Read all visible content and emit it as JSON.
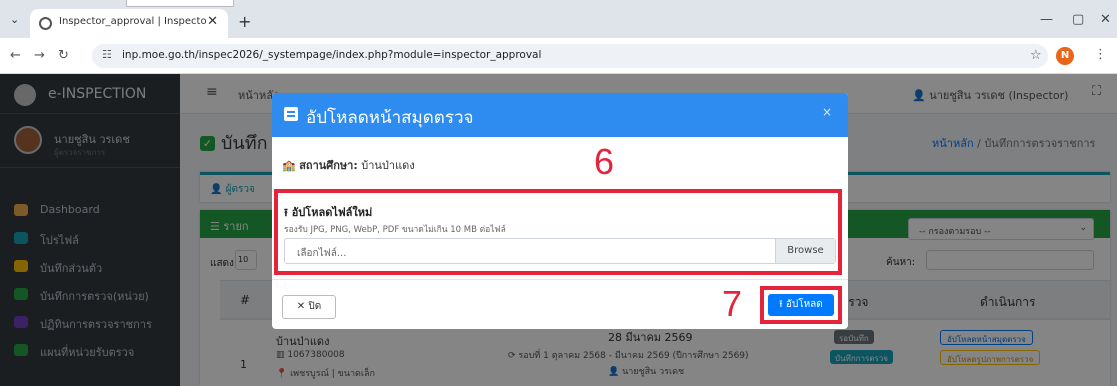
{
  "browser": {
    "tab_title": "Inspector_approval | Inspector",
    "tab_close": "✕",
    "new_tab": "+",
    "url": "inp.moe.go.th/inspec2026/_systempage/index.php?module=inspector_approval",
    "profile_initial": "N",
    "tab_list": "⌄",
    "minimize": "—",
    "maximize": "▢",
    "close": "✕"
  },
  "sidebar": {
    "brand": "e-INSPECTION",
    "user_name": "นายชูสิน วรเดช",
    "user_role": "ผู้ตรวจราชการ",
    "items": [
      {
        "label": "Dashboard",
        "color": "#f0ad4e"
      },
      {
        "label": "โปรไฟล์",
        "color": "#17a2b8"
      },
      {
        "label": "บันทึกส่วนตัว",
        "color": "#ffc107"
      },
      {
        "label": "บันทึกการตรวจ(หน่วย)",
        "color": "#28a745"
      },
      {
        "label": "ปฏิทินการตรวจราชการ",
        "color": "#6f42c1"
      },
      {
        "label": "แผนที่หน่วยรับตรวจ",
        "color": "#28a745"
      }
    ]
  },
  "topnav": {
    "home": "หน้าหลัก",
    "user": "นายชูสิน วรเดช (Inspector)"
  },
  "content": {
    "title": "บันทึก",
    "breadcrumb_home": "หน้าหลัก",
    "breadcrumb_sep": "/",
    "breadcrumb_current": "บันทึกการตรวจราชการ",
    "card1_title": "ผู้ตรวจ",
    "card2_title": "รายก",
    "round_select": "-- กรองตามรอบ --",
    "show_label": "แสดง",
    "show_value": "10",
    "search_label": "ค้นหา:",
    "columns": {
      "num": "#",
      "date": "การตรวจ",
      "action": "ดำเนินการ"
    },
    "row": {
      "num": "1",
      "school": "บ้านป่าแดง",
      "school_id": "1067380008",
      "location": "เพชรบูรณ์ | ขนาดเล็ก",
      "date": "28 มีนาคม 2569",
      "round": "รอบที่ 1 ตุลาคม 2568 - มีนาคม 2569 (ปีการศึกษา 2569)",
      "inspector": "นายชูสิน วรเดช",
      "status1": "รอบันทึก",
      "status2": "บันทึกการตรวจ",
      "action1": "อัปโหลดหน้าสมุดตรวจ",
      "action2": "อัปโหลดรูปภาพการตรวจ"
    }
  },
  "modal": {
    "title": "อัปโหลดหน้าสมุดตรวจ",
    "close_x": "×",
    "school_label": "สถานศึกษา:",
    "school_value": "บ้านป่าแดง",
    "upload_label": "อัปโหลดไฟล์ใหม่",
    "hint": "รองรับ JPG, PNG, WebP, PDF ขนาดไม่เกิน 10 MB ต่อไฟล์",
    "file_placeholder": "เลือกไฟล์...",
    "browse": "Browse",
    "close_button": "ปิด",
    "upload_button": "อัปโหลด",
    "annotation_6": "6",
    "annotation_7": "7"
  },
  "colors": {
    "modal_header": "#2e8cf0",
    "annotation_red": "#e5243b",
    "primary": "#007bff",
    "success": "#28a745"
  }
}
